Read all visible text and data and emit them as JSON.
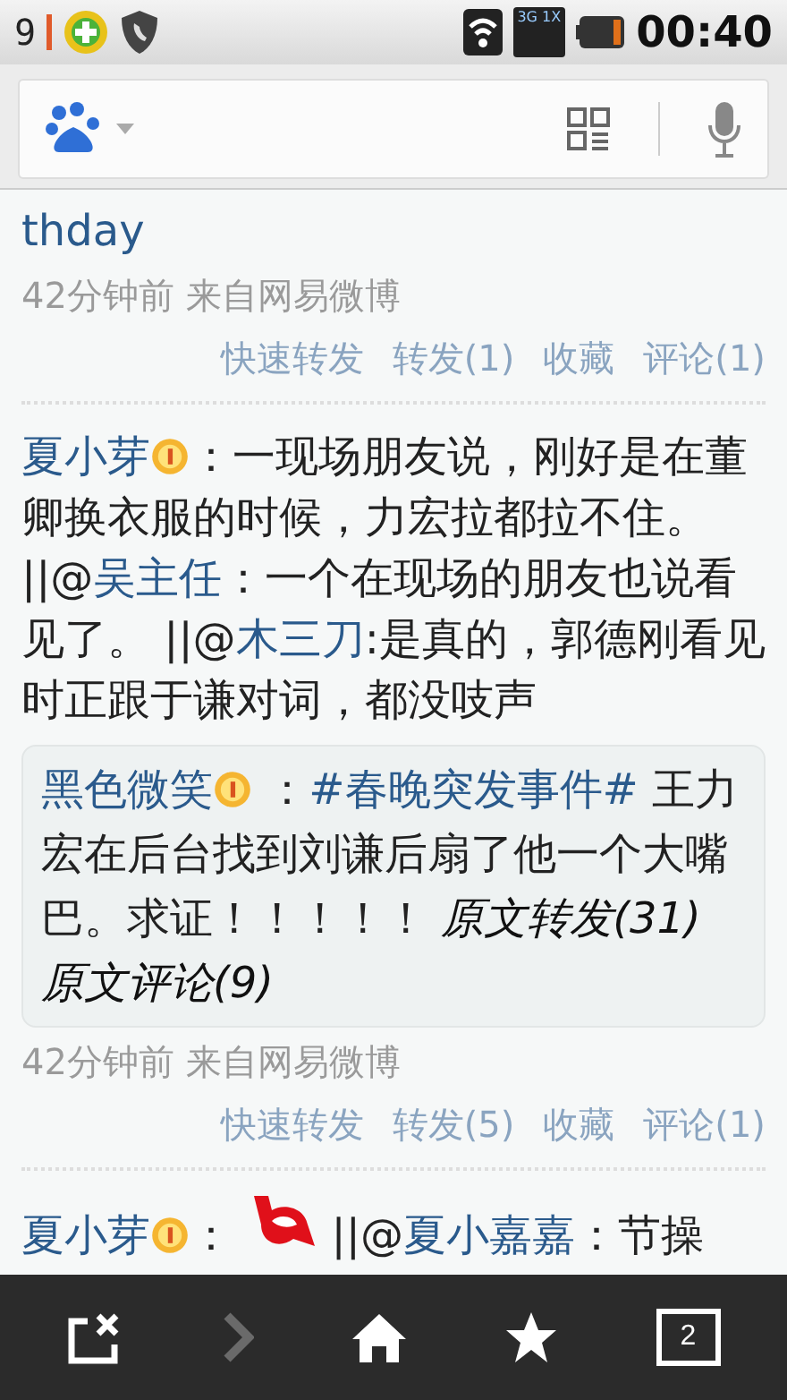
{
  "status_bar": {
    "notification": "9",
    "time": "00:40",
    "network": "3G 1X"
  },
  "posts": [
    {
      "segments": [
        {
          "kind": "mention",
          "text": "thday"
        }
      ],
      "meta": "42分钟前 来自网易微博",
      "actions": [
        "快速转发",
        "转发(1)",
        "收藏",
        "评论(1)"
      ]
    },
    {
      "author": "夏小芽",
      "segments": [
        {
          "kind": "badge"
        },
        {
          "kind": "text",
          "text": "：一现场朋友说，刚好是在董卿换衣服的时候，力宏拉都拉不住。 ||@"
        },
        {
          "kind": "mention",
          "text": "吴主任"
        },
        {
          "kind": "text",
          "text": "：一个在现场的朋友也说看见了。 ||@"
        },
        {
          "kind": "mention",
          "text": "木三刀"
        },
        {
          "kind": "text",
          "text": ":是真的，郭德刚看见时正跟于谦对词，都没吱声"
        }
      ],
      "quote": {
        "author": "黑色微笑",
        "segments": [
          {
            "kind": "badge"
          },
          {
            "kind": "text",
            "text": " ："
          },
          {
            "kind": "hashtag",
            "text": "#春晚突发事件#"
          },
          {
            "kind": "text",
            "text": " 王力宏在后台找到刘谦后扇了他一个大嘴巴。求证！！！！！ "
          },
          {
            "kind": "link",
            "text": "原文转发(31)"
          },
          {
            "kind": "link",
            "text": "原文评论(9)"
          }
        ]
      },
      "meta": "42分钟前 来自网易微博",
      "actions": [
        "快速转发",
        "转发(5)",
        "收藏",
        "评论(1)"
      ]
    },
    {
      "author": "夏小芽",
      "segments": [
        {
          "kind": "badge"
        },
        {
          "kind": "text",
          "text": "： "
        },
        {
          "kind": "emoticon"
        },
        {
          "kind": "text",
          "text": " ||@"
        },
        {
          "kind": "mention",
          "text": "夏小嘉嘉"
        },
        {
          "kind": "text",
          "text": "：节操"
        }
      ]
    }
  ],
  "toolbar": {
    "forward_disabled": true,
    "tab_count": "2"
  }
}
